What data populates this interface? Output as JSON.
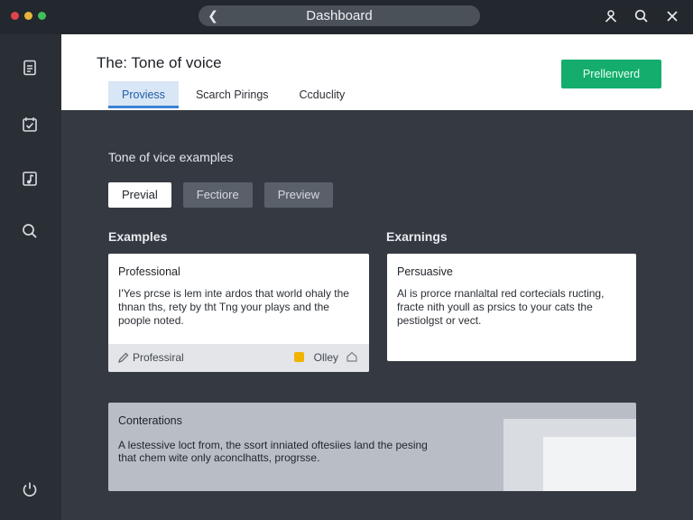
{
  "window": {
    "address_title": "Dashboard",
    "traffic_colors": [
      "#e0444c",
      "#e5b53b",
      "#3fbf5a"
    ]
  },
  "icons": {
    "back": "chevron-left-icon",
    "user": "user-icon",
    "search": "search-icon",
    "close": "close-icon"
  },
  "header": {
    "title": "The: Tone of voice",
    "tabs": [
      {
        "label": "Proviess",
        "active": true
      },
      {
        "label": "Scarch Pirings",
        "active": false
      },
      {
        "label": "Ccduclity",
        "active": false
      }
    ],
    "primary_button": "Prellenverd"
  },
  "content": {
    "section_title": "Tone of vice examples",
    "chips": [
      {
        "label": "Previal",
        "active": true
      },
      {
        "label": "Fectiore",
        "active": false
      },
      {
        "label": "Preview",
        "active": false
      }
    ],
    "left_label": "Examples",
    "right_label": "Exarnings",
    "cards": [
      {
        "title": "Professional",
        "body": "I'Yes prcse is lem inte ardos that world ohaly the thnan ths, rety by tht Tng your plays and the poople noted.",
        "footer_tag": "Professiral",
        "footer_owner": "Olley"
      },
      {
        "title": "Persuasive",
        "body": "Al is prorce rnanlaltal red cortecials ructing, fracte nith youll as prsics to your cats the pestiolgst or vect."
      }
    ],
    "panel": {
      "title": "Conterations",
      "body": "A lestessive loct from, the ssort inniated oftesiies land the pesing that chem wite only aconclhatts, progrsse."
    }
  },
  "colors": {
    "accent_green": "#14ad6d",
    "active_tab": "#3b82d6",
    "sidebar_bg": "#2a2e35",
    "content_bg": "#353a42"
  }
}
